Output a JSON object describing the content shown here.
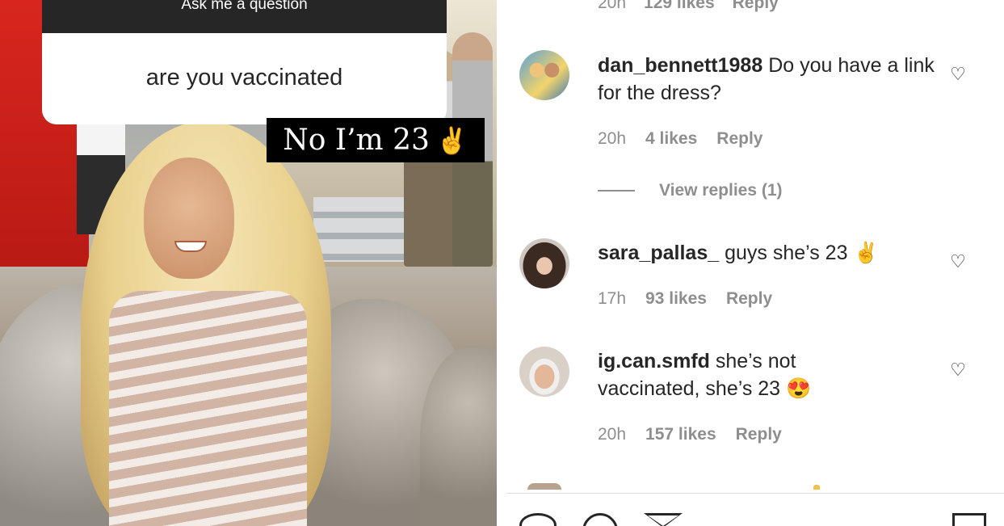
{
  "story": {
    "question_title": "Ask me a question",
    "question_answer": "are you vaccinated",
    "reply_caption": "No I’m 23",
    "reply_emoji": "✌"
  },
  "comments": {
    "previous_meta": {
      "time": "20h",
      "likes": "129 likes",
      "reply": "Reply"
    },
    "items": [
      {
        "username": "dan_bennett1988",
        "text": " Do you have a link for the dress?",
        "emoji": "",
        "time": "20h",
        "likes": "4 likes",
        "reply": "Reply"
      },
      {
        "username": "sara_pallas_",
        "text": " guys she’s 23 ",
        "emoji": "✌",
        "time": "17h",
        "likes": "93 likes",
        "reply": "Reply"
      },
      {
        "username": "ig.can.smfd",
        "text": " she’s not vaccinated, she’s 23 ",
        "emoji": "😍",
        "time": "20h",
        "likes": "157 likes",
        "reply": "Reply"
      }
    ],
    "view_replies": "View replies (1)"
  },
  "icons": [
    "heart-icon",
    "comment-icon",
    "share-icon",
    "bookmark-icon",
    "like-comment-heart-icon"
  ],
  "colors": {
    "text": "#262626",
    "meta": "#8e8e8e",
    "sticker_header": "#262626",
    "caption_bg": "#000000"
  }
}
